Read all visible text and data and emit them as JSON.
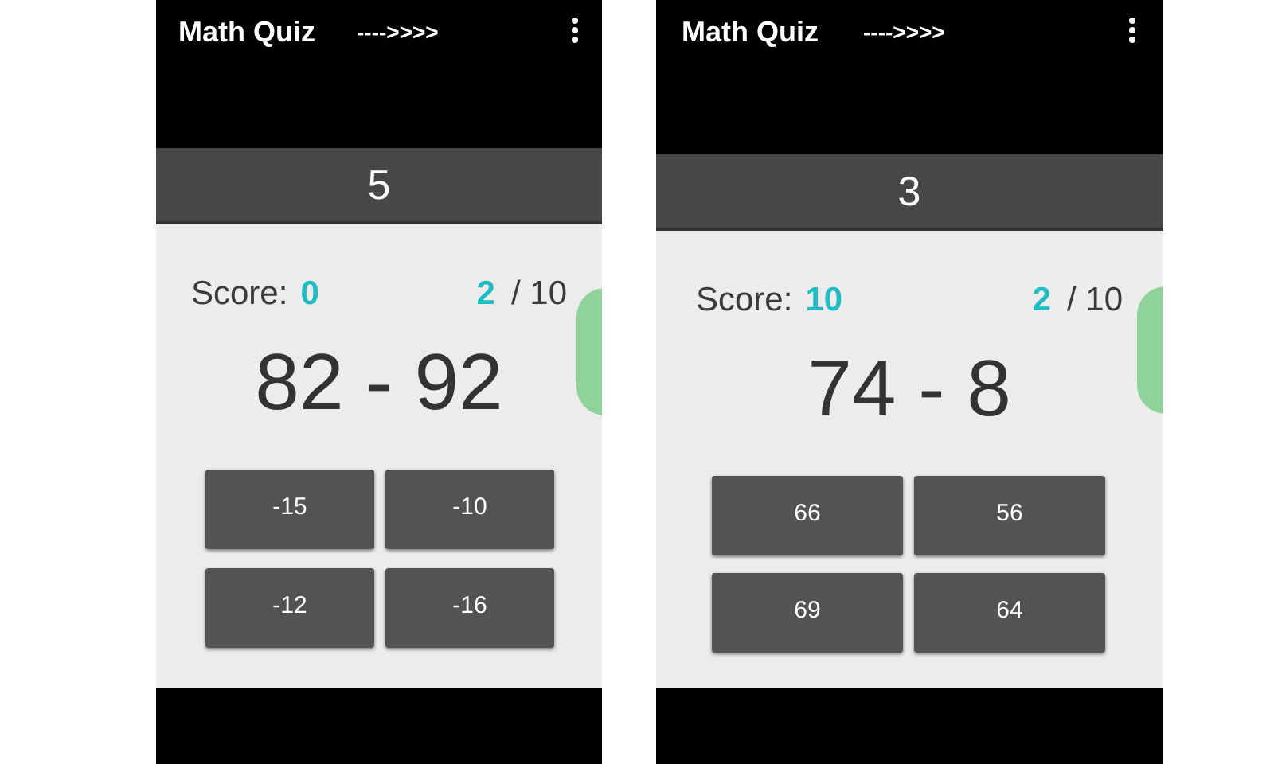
{
  "screens": [
    {
      "app_title": "Math Quiz",
      "arrow_text": "---->>>>",
      "timer": "5",
      "score_label": "Score:",
      "score": "0",
      "question_number": "2",
      "question_total": "/ 10",
      "question": "82 - 92",
      "answers": [
        "-15",
        "-10",
        "-12",
        "-16"
      ]
    },
    {
      "app_title": "Math Quiz",
      "arrow_text": "---->>>>",
      "timer": "3",
      "score_label": "Score:",
      "score": "10",
      "question_number": "2",
      "question_total": "/ 10",
      "question": "74 - 8",
      "answers": [
        "66",
        "56",
        "69",
        "64"
      ]
    }
  ]
}
